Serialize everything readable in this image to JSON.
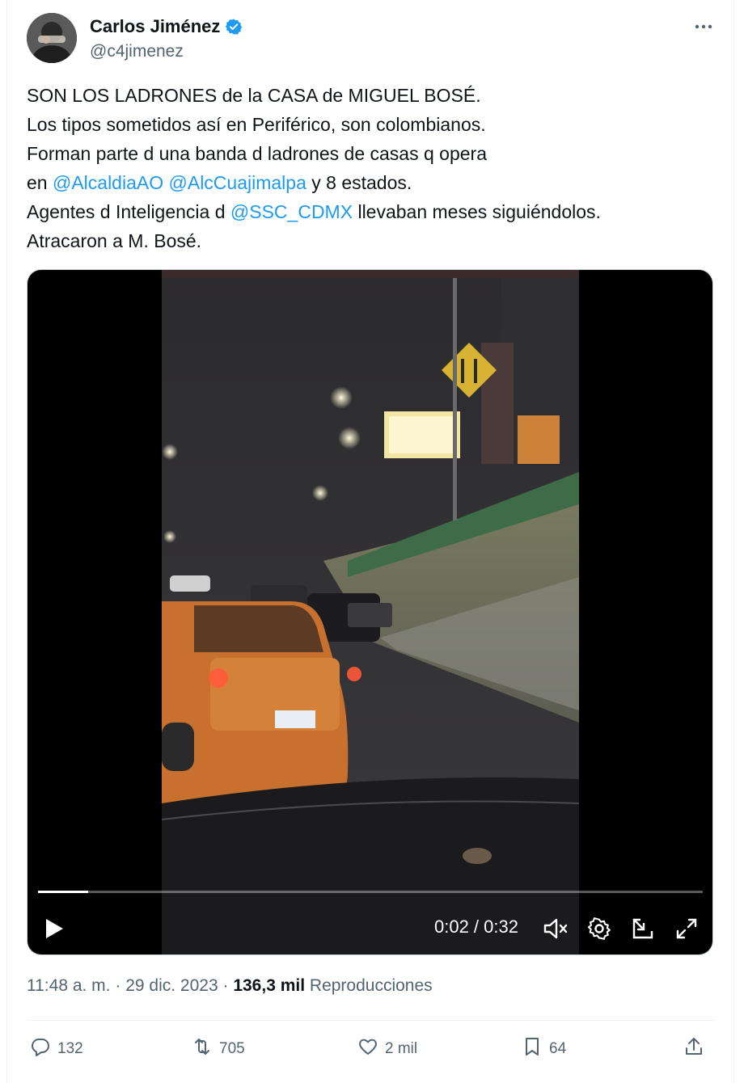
{
  "author": {
    "name": "Carlos Jiménez",
    "handle": "@c4jimenez",
    "verified": true
  },
  "tweet": {
    "lines": [
      [
        {
          "t": "SON LOS LADRONES de la CASA de MIGUEL BOSÉ."
        }
      ],
      [
        {
          "t": "Los tipos sometidos así en Periférico, son colombianos."
        }
      ],
      [
        {
          "t": "Forman parte d una banda d ladrones de casas q opera"
        }
      ],
      [
        {
          "t": "en "
        },
        {
          "t": "@AlcaldiaAO",
          "m": true
        },
        {
          "t": " "
        },
        {
          "t": "@AlcCuajimalpa",
          "m": true
        },
        {
          "t": " y 8 estados."
        }
      ],
      [
        {
          "t": "Agentes d Inteligencia d "
        },
        {
          "t": "@SSC_CDMX",
          "m": true
        },
        {
          "t": " llevaban meses siguiéndolos."
        }
      ],
      [
        {
          "t": "Atracaron a M. Bosé."
        }
      ]
    ]
  },
  "video": {
    "current_time": "0:02",
    "duration": "0:32",
    "time_display": "0:02 / 0:32",
    "progress_fraction": 0.076
  },
  "meta": {
    "time": "11:48 a. m.",
    "separator": "·",
    "date": "29 dic. 2023",
    "views_count": "136,3 mil",
    "views_label": "Reproducciones"
  },
  "actions": {
    "replies": "132",
    "reposts": "705",
    "likes": "2 mil",
    "bookmarks": "64"
  },
  "colors": {
    "mention": "#1d9bf0",
    "secondary_text": "#536471",
    "primary_text": "#0f1419",
    "verified": "#1d9bf0"
  },
  "icons": [
    "verified-badge-icon",
    "more-icon",
    "play-icon",
    "mute-icon",
    "settings-icon",
    "picture-in-picture-icon",
    "fullscreen-icon",
    "reply-icon",
    "repost-icon",
    "like-icon",
    "bookmark-icon",
    "share-icon"
  ]
}
